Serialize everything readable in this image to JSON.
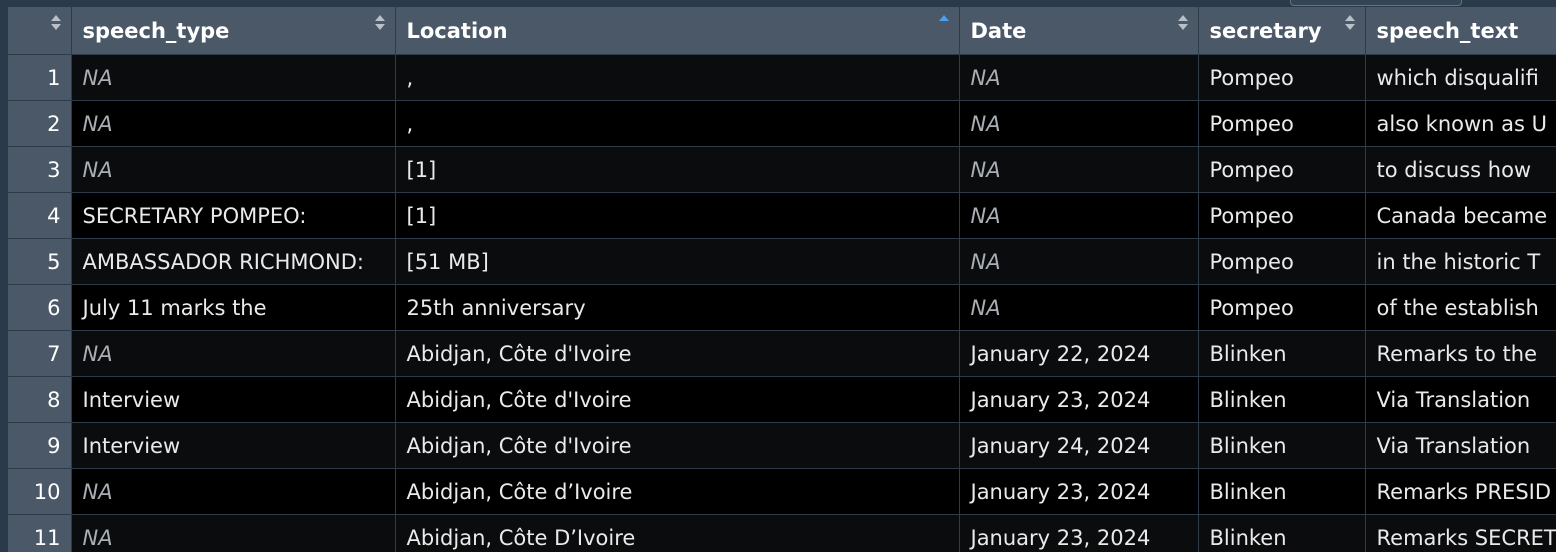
{
  "table": {
    "columns": [
      {
        "label": "",
        "sort": "none"
      },
      {
        "label": "speech_type",
        "sort": "none"
      },
      {
        "label": "Location",
        "sort": "asc"
      },
      {
        "label": "Date",
        "sort": "none"
      },
      {
        "label": "secretary",
        "sort": "none"
      },
      {
        "label": "speech_text",
        "sort": "none"
      }
    ],
    "rows": [
      {
        "n": "1",
        "speech_type": "NA",
        "location": ",",
        "date": "NA",
        "secretary": "Pompeo",
        "speech_text": "which disqualifi"
      },
      {
        "n": "2",
        "speech_type": "NA",
        "location": ",",
        "date": "NA",
        "secretary": "Pompeo",
        "speech_text": "also known as U"
      },
      {
        "n": "3",
        "speech_type": "NA",
        "location": "[1]",
        "date": "NA",
        "secretary": "Pompeo",
        "speech_text": "to discuss how"
      },
      {
        "n": "4",
        "speech_type": "SECRETARY POMPEO:",
        "location": "[1]",
        "date": "NA",
        "secretary": "Pompeo",
        "speech_text": "Canada became"
      },
      {
        "n": "5",
        "speech_type": "AMBASSADOR RICHMOND:",
        "location": "[51 MB]",
        "date": "NA",
        "secretary": "Pompeo",
        "speech_text": "in the historic T"
      },
      {
        "n": "6",
        "speech_type": "July 11 marks the",
        "location": "25th anniversary",
        "date": "NA",
        "secretary": "Pompeo",
        "speech_text": "of the establish"
      },
      {
        "n": "7",
        "speech_type": "NA",
        "location": "Abidjan, Côte d'Ivoire",
        "date": "January 22, 2024",
        "secretary": "Blinken",
        "speech_text": "Remarks to the"
      },
      {
        "n": "8",
        "speech_type": "Interview",
        "location": "Abidjan, Côte d'Ivoire",
        "date": "January 23, 2024",
        "secretary": "Blinken",
        "speech_text": "Via Translation"
      },
      {
        "n": "9",
        "speech_type": "Interview",
        "location": "Abidjan, Côte d'Ivoire",
        "date": "January 24, 2024",
        "secretary": "Blinken",
        "speech_text": "Via Translation"
      },
      {
        "n": "10",
        "speech_type": "NA",
        "location": "Abidjan, Côte d’Ivoire",
        "date": "January 23, 2024",
        "secretary": "Blinken",
        "speech_text": "Remarks PRESID"
      },
      {
        "n": "11",
        "speech_type": "NA",
        "location": "Abidjan, Côte D’Ivoire",
        "date": "January 23, 2024",
        "secretary": "Blinken",
        "speech_text": "Remarks SECRET"
      }
    ]
  }
}
